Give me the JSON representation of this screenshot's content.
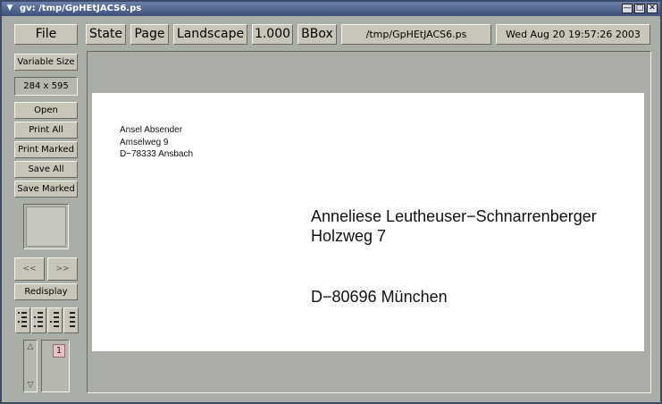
{
  "window": {
    "title": "gv: /tmp/GpHEtJACS6.ps",
    "menu_icon": "chevron-down-icon",
    "controls": [
      "minimize-icon",
      "maximize-icon",
      "close-icon"
    ]
  },
  "toolbar": {
    "file": "File",
    "state": "State",
    "page": "Page",
    "orientation": "Landscape",
    "scale": "1.000",
    "bbox": "BBox",
    "filename": "/tmp/GpHEtJACS6.ps",
    "datetime": "Wed Aug 20 19:57:26 2003"
  },
  "sidebar": {
    "size_mode": "Variable Size",
    "dimensions": "284 x 595",
    "open": "Open",
    "print_all": "Print All",
    "print_marked": "Print Marked",
    "save_all": "Save All",
    "save_marked": "Save Marked",
    "prev_page": "<<",
    "next_page": ">>",
    "redisplay": "Redisplay",
    "page_list": [
      "1"
    ]
  },
  "document": {
    "sender": [
      "Ansel Absender",
      "Amselweg 9",
      "D−78333 Ansbach"
    ],
    "recipient": [
      "Anneliese Leutheuser−Schnarrenberger",
      "Holzweg 7"
    ],
    "city": "D−80696 München"
  }
}
